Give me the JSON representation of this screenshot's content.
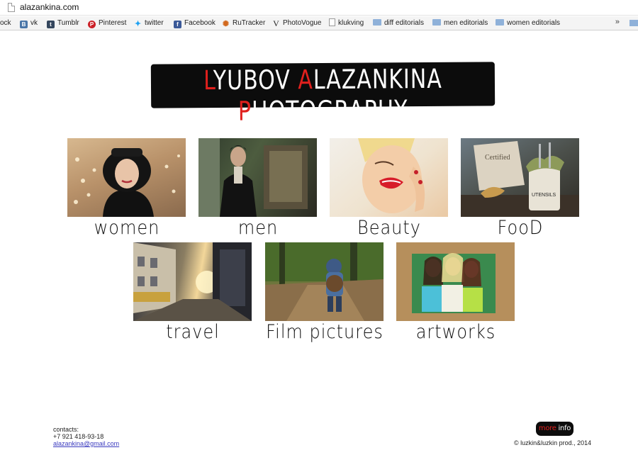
{
  "browser": {
    "url": "alazankina.com",
    "bookmarks": [
      {
        "label": "ock",
        "icon": "none"
      },
      {
        "label": "vk",
        "icon": "vk-icon"
      },
      {
        "label": "Tumblr",
        "icon": "tumblr-icon"
      },
      {
        "label": "Pinterest",
        "icon": "pinterest-icon"
      },
      {
        "label": "twitter",
        "icon": "twitter-icon"
      },
      {
        "label": "Facebook",
        "icon": "facebook-icon"
      },
      {
        "label": "RuTracker",
        "icon": "rutracker-icon"
      },
      {
        "label": "PhotoVogue",
        "icon": "photovogue-icon"
      },
      {
        "label": "klukving",
        "icon": "page-icon"
      },
      {
        "label": "diff editorials",
        "icon": "folder-icon"
      },
      {
        "label": "men editorials",
        "icon": "folder-icon"
      },
      {
        "label": "women editorials",
        "icon": "folder-icon"
      }
    ],
    "more_glyph": "»"
  },
  "logo": {
    "initial_1": "L",
    "rest_1": "YUBOV ",
    "initial_2": "A",
    "rest_2": "LAZANKINA ",
    "initial_3": "P",
    "rest_3": "HOTOGRAPHY",
    "accent_color": "#e0201d",
    "background": "#0c0c0c"
  },
  "gallery": [
    {
      "label": "women"
    },
    {
      "label": "men"
    },
    {
      "label": "Beauty"
    },
    {
      "label": "FooD"
    },
    {
      "label": "travel"
    },
    {
      "label": "Film pictures"
    },
    {
      "label": "artworks"
    }
  ],
  "footer": {
    "contacts_heading": "contacts:",
    "phone": "+7 921 418-93-18",
    "email": "alazankina@gmail.com",
    "more_info_accent": "more",
    "more_info_rest": " info",
    "copyright": "© luzkin&luzkin prod., 2014"
  }
}
